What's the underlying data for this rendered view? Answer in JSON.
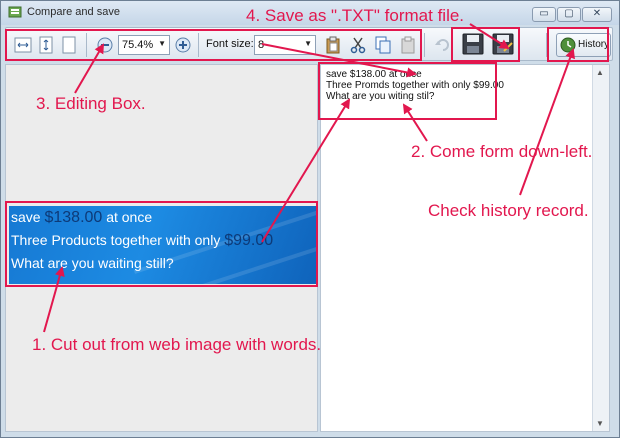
{
  "window": {
    "title": "Compare and save",
    "minimize_glyph": "▭",
    "maximize_glyph": "▢",
    "close_glyph": "✕"
  },
  "toolbar": {
    "zoom_value": "75.4%",
    "font_size_label": "Font size:",
    "font_size_value": "8",
    "history_label": "History"
  },
  "icons": [
    "fit-width-icon",
    "fit-height-icon",
    "page-icon",
    "zoom-out-icon",
    "zoom-in-icon",
    "paste-icon",
    "cut-icon",
    "copy-icon",
    "clipboard-icon",
    "undo-icon",
    "save-icon",
    "save-as-icon",
    "history-icon"
  ],
  "left_image": {
    "line1_a": "save ",
    "line1_price": "$138.00",
    "line1_b": " at once",
    "line2_a": "Three Products together with only ",
    "line2_price": "$99.00",
    "line3": "What are you waiting still?"
  },
  "editor_text": {
    "line1": "save $138.00 at once",
    "line2": "Three Promds together with only $99.00",
    "line3": "What are you witing stil?"
  },
  "annotations": {
    "save_txt": "4. Save as \".TXT\" format file.",
    "editing_box": "3. Editing Box.",
    "come_from": "2. Come form down-left.",
    "history": "Check history record.",
    "cut_out": "1. Cut out from web image with words."
  },
  "colors": {
    "annotation": "#e2174e",
    "image_blue": "#1a80da",
    "price_blue": "#0d3a78"
  }
}
